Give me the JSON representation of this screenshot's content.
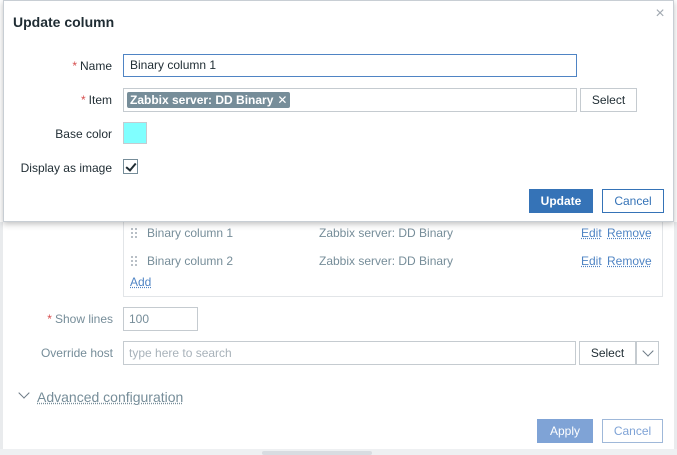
{
  "dialog": {
    "title": "Update column",
    "fields": {
      "name": {
        "label": "Name",
        "value": "Binary column 1"
      },
      "item": {
        "label": "Item",
        "tag": "Zabbix server: DD Binary",
        "tag_remove": "✕",
        "select_label": "Select"
      },
      "base_color": {
        "label": "Base color",
        "value": "#80ffff"
      },
      "display_as_image": {
        "label": "Display as image",
        "checked": true
      }
    },
    "update_label": "Update",
    "cancel_label": "Cancel"
  },
  "background": {
    "columns": [
      {
        "name": "Binary column 1",
        "item": "Zabbix server: DD Binary",
        "edit": "Edit",
        "remove": "Remove"
      },
      {
        "name": "Binary column 2",
        "item": "Zabbix server: DD Binary",
        "edit": "Edit",
        "remove": "Remove"
      }
    ],
    "add_label": "Add",
    "show_lines": {
      "label": "Show lines",
      "value": "100"
    },
    "override_host": {
      "label": "Override host",
      "placeholder": "type here to search",
      "select_label": "Select"
    },
    "advanced_configuration": "Advanced configuration",
    "apply_label": "Apply",
    "cancel_label": "Cancel"
  },
  "colors": {
    "primary": "#3573b7",
    "required": "#d64e4e",
    "tag_bg": "#768d99",
    "swatch": "#80ffff"
  }
}
